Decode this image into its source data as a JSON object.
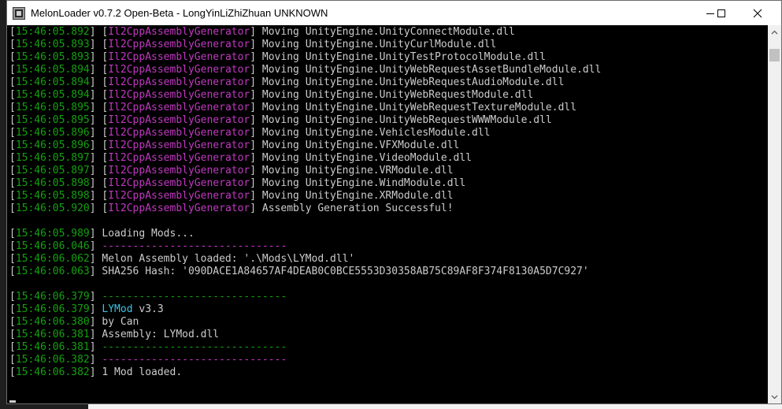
{
  "window": {
    "title": "MelonLoader v0.7.2 Open-Beta - LongYinLiZhiZhuan UNKNOWN",
    "controls": [
      "minimize",
      "maximize",
      "close"
    ]
  },
  "colors": {
    "timestamp": "#13a10e",
    "text": "#cccccc",
    "generator_tag": "#c238c2",
    "mod_name": "#3bc3e0",
    "background": "#000000"
  },
  "console": {
    "lines": [
      [
        {
          "t": "[",
          "c": "gr"
        },
        {
          "t": "15:46:05.892",
          "c": "g"
        },
        {
          "t": "] [",
          "c": "gr"
        },
        {
          "t": "Il2CppAssemblyGenerator",
          "c": "m"
        },
        {
          "t": "] Moving UnityEngine.UnityConnectModule.dll",
          "c": "gr"
        }
      ],
      [
        {
          "t": "[",
          "c": "gr"
        },
        {
          "t": "15:46:05.893",
          "c": "g"
        },
        {
          "t": "] [",
          "c": "gr"
        },
        {
          "t": "Il2CppAssemblyGenerator",
          "c": "m"
        },
        {
          "t": "] Moving UnityEngine.UnityCurlModule.dll",
          "c": "gr"
        }
      ],
      [
        {
          "t": "[",
          "c": "gr"
        },
        {
          "t": "15:46:05.893",
          "c": "g"
        },
        {
          "t": "] [",
          "c": "gr"
        },
        {
          "t": "Il2CppAssemblyGenerator",
          "c": "m"
        },
        {
          "t": "] Moving UnityEngine.UnityTestProtocolModule.dll",
          "c": "gr"
        }
      ],
      [
        {
          "t": "[",
          "c": "gr"
        },
        {
          "t": "15:46:05.894",
          "c": "g"
        },
        {
          "t": "] [",
          "c": "gr"
        },
        {
          "t": "Il2CppAssemblyGenerator",
          "c": "m"
        },
        {
          "t": "] Moving UnityEngine.UnityWebRequestAssetBundleModule.dll",
          "c": "gr"
        }
      ],
      [
        {
          "t": "[",
          "c": "gr"
        },
        {
          "t": "15:46:05.894",
          "c": "g"
        },
        {
          "t": "] [",
          "c": "gr"
        },
        {
          "t": "Il2CppAssemblyGenerator",
          "c": "m"
        },
        {
          "t": "] Moving UnityEngine.UnityWebRequestAudioModule.dll",
          "c": "gr"
        }
      ],
      [
        {
          "t": "[",
          "c": "gr"
        },
        {
          "t": "15:46:05.894",
          "c": "g"
        },
        {
          "t": "] [",
          "c": "gr"
        },
        {
          "t": "Il2CppAssemblyGenerator",
          "c": "m"
        },
        {
          "t": "] Moving UnityEngine.UnityWebRequestModule.dll",
          "c": "gr"
        }
      ],
      [
        {
          "t": "[",
          "c": "gr"
        },
        {
          "t": "15:46:05.895",
          "c": "g"
        },
        {
          "t": "] [",
          "c": "gr"
        },
        {
          "t": "Il2CppAssemblyGenerator",
          "c": "m"
        },
        {
          "t": "] Moving UnityEngine.UnityWebRequestTextureModule.dll",
          "c": "gr"
        }
      ],
      [
        {
          "t": "[",
          "c": "gr"
        },
        {
          "t": "15:46:05.895",
          "c": "g"
        },
        {
          "t": "] [",
          "c": "gr"
        },
        {
          "t": "Il2CppAssemblyGenerator",
          "c": "m"
        },
        {
          "t": "] Moving UnityEngine.UnityWebRequestWWWModule.dll",
          "c": "gr"
        }
      ],
      [
        {
          "t": "[",
          "c": "gr"
        },
        {
          "t": "15:46:05.896",
          "c": "g"
        },
        {
          "t": "] [",
          "c": "gr"
        },
        {
          "t": "Il2CppAssemblyGenerator",
          "c": "m"
        },
        {
          "t": "] Moving UnityEngine.VehiclesModule.dll",
          "c": "gr"
        }
      ],
      [
        {
          "t": "[",
          "c": "gr"
        },
        {
          "t": "15:46:05.896",
          "c": "g"
        },
        {
          "t": "] [",
          "c": "gr"
        },
        {
          "t": "Il2CppAssemblyGenerator",
          "c": "m"
        },
        {
          "t": "] Moving UnityEngine.VFXModule.dll",
          "c": "gr"
        }
      ],
      [
        {
          "t": "[",
          "c": "gr"
        },
        {
          "t": "15:46:05.897",
          "c": "g"
        },
        {
          "t": "] [",
          "c": "gr"
        },
        {
          "t": "Il2CppAssemblyGenerator",
          "c": "m"
        },
        {
          "t": "] Moving UnityEngine.VideoModule.dll",
          "c": "gr"
        }
      ],
      [
        {
          "t": "[",
          "c": "gr"
        },
        {
          "t": "15:46:05.897",
          "c": "g"
        },
        {
          "t": "] [",
          "c": "gr"
        },
        {
          "t": "Il2CppAssemblyGenerator",
          "c": "m"
        },
        {
          "t": "] Moving UnityEngine.VRModule.dll",
          "c": "gr"
        }
      ],
      [
        {
          "t": "[",
          "c": "gr"
        },
        {
          "t": "15:46:05.898",
          "c": "g"
        },
        {
          "t": "] [",
          "c": "gr"
        },
        {
          "t": "Il2CppAssemblyGenerator",
          "c": "m"
        },
        {
          "t": "] Moving UnityEngine.WindModule.dll",
          "c": "gr"
        }
      ],
      [
        {
          "t": "[",
          "c": "gr"
        },
        {
          "t": "15:46:05.898",
          "c": "g"
        },
        {
          "t": "] [",
          "c": "gr"
        },
        {
          "t": "Il2CppAssemblyGenerator",
          "c": "m"
        },
        {
          "t": "] Moving UnityEngine.XRModule.dll",
          "c": "gr"
        }
      ],
      [
        {
          "t": "[",
          "c": "gr"
        },
        {
          "t": "15:46:05.920",
          "c": "g"
        },
        {
          "t": "] [",
          "c": "gr"
        },
        {
          "t": "Il2CppAssemblyGenerator",
          "c": "m"
        },
        {
          "t": "] Assembly Generation Successful!",
          "c": "gr"
        }
      ],
      [],
      [
        {
          "t": "[",
          "c": "gr"
        },
        {
          "t": "15:46:05.989",
          "c": "g"
        },
        {
          "t": "] Loading Mods...",
          "c": "gr"
        }
      ],
      [
        {
          "t": "[",
          "c": "gr"
        },
        {
          "t": "15:46:06.046",
          "c": "g"
        },
        {
          "t": "] ",
          "c": "gr"
        },
        {
          "t": "------------------------------",
          "c": "m"
        }
      ],
      [
        {
          "t": "[",
          "c": "gr"
        },
        {
          "t": "15:46:06.062",
          "c": "g"
        },
        {
          "t": "] Melon Assembly loaded: '.\\Mods\\LYMod.dll'",
          "c": "gr"
        }
      ],
      [
        {
          "t": "[",
          "c": "gr"
        },
        {
          "t": "15:46:06.063",
          "c": "g"
        },
        {
          "t": "] SHA256 Hash: '090DACE1A84657AF4DEAB0C0BCE5553D30358AB75C89AF8F374F8130A5D7C927'",
          "c": "gr"
        }
      ],
      [],
      [
        {
          "t": "[",
          "c": "gr"
        },
        {
          "t": "15:46:06.379",
          "c": "g"
        },
        {
          "t": "] ",
          "c": "gr"
        },
        {
          "t": "------------------------------",
          "c": "g"
        }
      ],
      [
        {
          "t": "[",
          "c": "gr"
        },
        {
          "t": "15:46:06.379",
          "c": "g"
        },
        {
          "t": "] ",
          "c": "gr"
        },
        {
          "t": "LYMod",
          "c": "c"
        },
        {
          "t": " v3.3",
          "c": "gr"
        }
      ],
      [
        {
          "t": "[",
          "c": "gr"
        },
        {
          "t": "15:46:06.380",
          "c": "g"
        },
        {
          "t": "] by Can",
          "c": "gr"
        }
      ],
      [
        {
          "t": "[",
          "c": "gr"
        },
        {
          "t": "15:46:06.381",
          "c": "g"
        },
        {
          "t": "] Assembly: LYMod.dll",
          "c": "gr"
        }
      ],
      [
        {
          "t": "[",
          "c": "gr"
        },
        {
          "t": "15:46:06.381",
          "c": "g"
        },
        {
          "t": "] ",
          "c": "gr"
        },
        {
          "t": "------------------------------",
          "c": "g"
        }
      ],
      [
        {
          "t": "[",
          "c": "gr"
        },
        {
          "t": "15:46:06.382",
          "c": "g"
        },
        {
          "t": "] ",
          "c": "gr"
        },
        {
          "t": "------------------------------",
          "c": "m"
        }
      ],
      [
        {
          "t": "[",
          "c": "gr"
        },
        {
          "t": "15:46:06.382",
          "c": "g"
        },
        {
          "t": "] 1 Mod loaded.",
          "c": "gr"
        }
      ]
    ]
  }
}
